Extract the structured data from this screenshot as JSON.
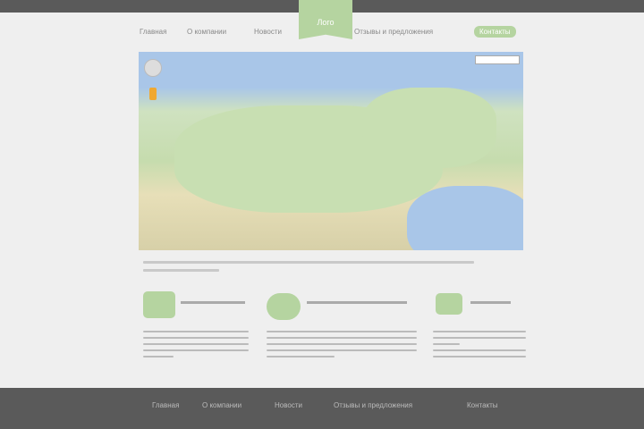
{
  "header": {
    "logo": "Лого",
    "nav": [
      "Главная",
      "О компании",
      "Новости",
      "Отзывы и предложения",
      "Контакты"
    ],
    "active_index": 4
  },
  "colors": {
    "accent": "#b5d4a0",
    "bar": "#5a5a5a",
    "background": "#efefef"
  },
  "features": [
    {
      "icon": "buildings-icon"
    },
    {
      "icon": "piggy-bank-icon"
    },
    {
      "icon": "contacts-icon"
    }
  ],
  "footer": {
    "nav": [
      "Главная",
      "О компании",
      "Новости",
      "Отзывы и предложения",
      "Контакты"
    ]
  }
}
